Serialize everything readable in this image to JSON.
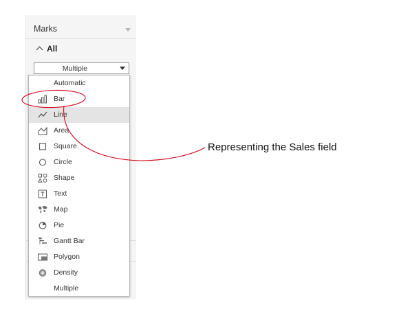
{
  "marks_card": {
    "title": "Marks",
    "section_label": "All",
    "mark_type_select": {
      "value": "Multiple"
    }
  },
  "dropdown": {
    "items": [
      {
        "label": "Automatic",
        "icon": "none"
      },
      {
        "label": "Bar",
        "icon": "bar-icon"
      },
      {
        "label": "Line",
        "icon": "line-icon",
        "highlighted": true
      },
      {
        "label": "Area",
        "icon": "area-icon"
      },
      {
        "label": "Square",
        "icon": "square-icon"
      },
      {
        "label": "Circle",
        "icon": "circle-icon"
      },
      {
        "label": "Shape",
        "icon": "shape-icon"
      },
      {
        "label": "Text",
        "icon": "text-icon"
      },
      {
        "label": "Map",
        "icon": "map-icon"
      },
      {
        "label": "Pie",
        "icon": "pie-icon"
      },
      {
        "label": "Gantt Bar",
        "icon": "gantt-bar-icon"
      },
      {
        "label": "Polygon",
        "icon": "polygon-icon"
      },
      {
        "label": "Density",
        "icon": "density-icon"
      },
      {
        "label": "Multiple",
        "icon": "none"
      }
    ]
  },
  "annotation": {
    "text": "Representing the Sales field",
    "color": "#d0021b"
  },
  "colors": {
    "highlight": "#e4e4e4",
    "panel_bg": "#f5f5f5",
    "annotation_red": "#d0021b"
  }
}
